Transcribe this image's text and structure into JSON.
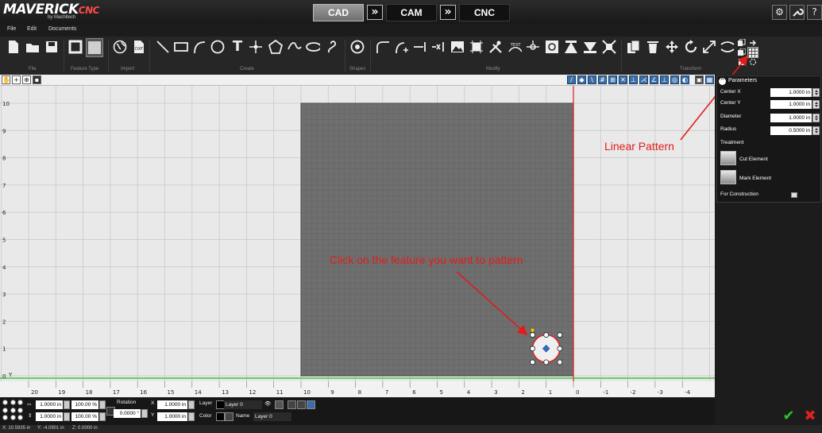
{
  "app": {
    "logo_main": "MAVERICK",
    "logo_suffix": "CNC",
    "logo_sub": "by Machitech"
  },
  "modes": [
    {
      "label": "CAD",
      "active": true
    },
    {
      "label": "CAM",
      "active": false
    },
    {
      "label": "CNC",
      "active": false
    }
  ],
  "mode_separator": "»",
  "system_buttons": [
    {
      "icon": "settings-icon",
      "glyph": "⚙"
    },
    {
      "icon": "wrench-icon",
      "glyph": "🔧"
    },
    {
      "icon": "help-icon",
      "glyph": "?"
    }
  ],
  "menu": [
    "File",
    "Edit",
    "Documents"
  ],
  "ribbon": {
    "groups": [
      "File",
      "Feature Type",
      "Import",
      "Create",
      "Shapes",
      "Modify",
      "Transform"
    ]
  },
  "canvas": {
    "y_ticks": [
      "10",
      "9",
      "8",
      "7",
      "6",
      "5",
      "4",
      "3",
      "2",
      "1",
      "0"
    ],
    "x_ticks": [
      "20",
      "19",
      "18",
      "17",
      "16",
      "15",
      "14",
      "13",
      "12",
      "11",
      "10",
      "9",
      "8",
      "7",
      "6",
      "5",
      "4",
      "3",
      "2",
      "1",
      "0",
      "-1",
      "-2",
      "-3",
      "-4"
    ],
    "origin_axis_label": "Y",
    "colors": {
      "background": "#e9e9e9",
      "grid": "#c9c9c9",
      "material": "#6f6f6f",
      "material_grid": "#5f5f5f",
      "x_axis": "#1fbf1f",
      "y_axis": "#e31b1b",
      "annotation": "#e31b1b"
    }
  },
  "annotations": {
    "click_feature": "Click on the feature you want to pattern",
    "linear_pattern": "Linear Pattern"
  },
  "parameters": {
    "title": "Parameters",
    "fields": [
      {
        "label": "Center X",
        "value": "1.0000 in"
      },
      {
        "label": "Center Y",
        "value": "1.0000 in"
      },
      {
        "label": "Diameter",
        "value": "1.0000 in"
      },
      {
        "label": "Radius",
        "value": "0.5000 in"
      }
    ],
    "treatment_label": "Treatment",
    "treatments": [
      {
        "label": "Cut Element"
      },
      {
        "label": "Mark Element"
      }
    ],
    "for_construction": "For Construction"
  },
  "bottom": {
    "width_value": "1.0000 in",
    "width_pct": "100.00 %",
    "height_value": "1.0000 in",
    "height_pct": "100.00 %",
    "rotation_label": "Rotation",
    "rotation_value": "0.0000 °",
    "x_label": "X",
    "x_value": "1.0000 in",
    "y_label": "Y",
    "y_value": "1.0000 in",
    "layer_label": "Layer",
    "layer_value": "Layer 0",
    "color_label": "Color",
    "name_label": "Name",
    "name_value": "Layer 0"
  },
  "status": {
    "x": "X: 10.5935 in",
    "y": "Y: -4.0901 in",
    "z": "Z: 0.0000 in"
  }
}
